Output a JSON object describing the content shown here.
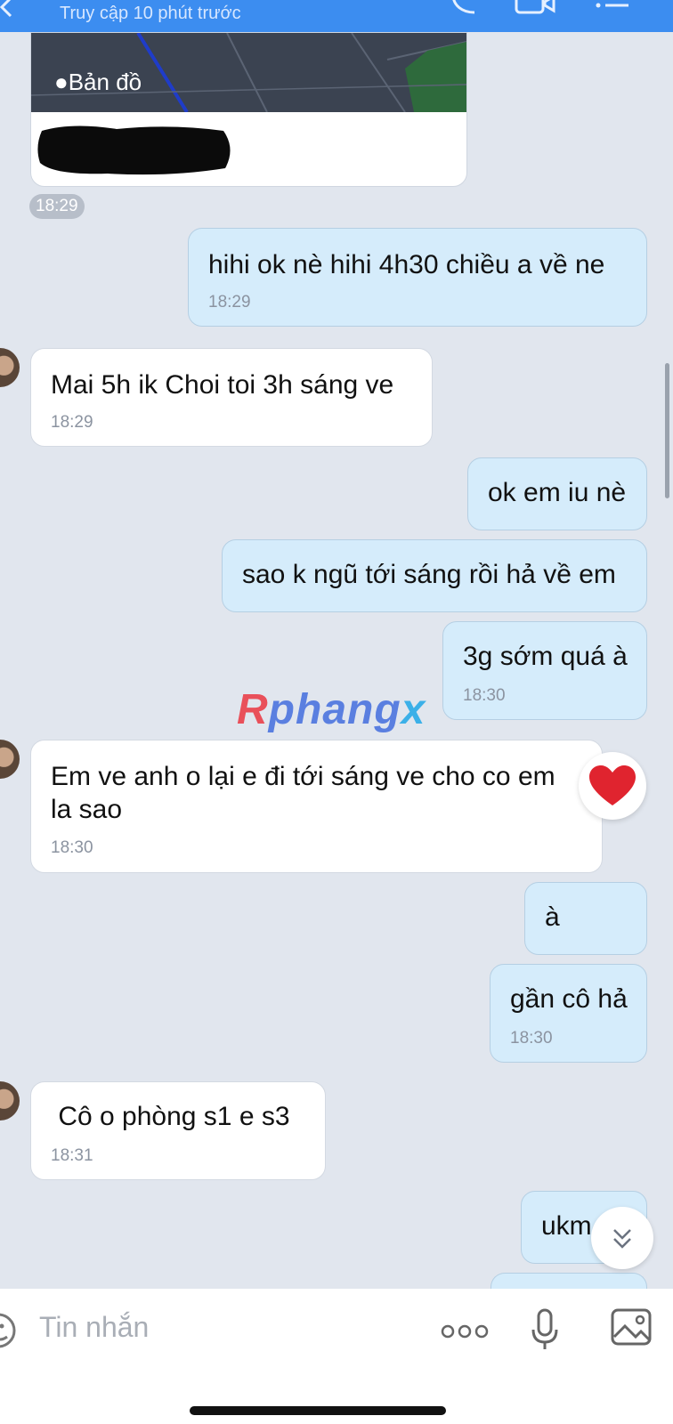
{
  "header": {
    "subtitle": "Truy cập 10 phút trước",
    "icons": [
      "back-arrow-icon",
      "phone-icon",
      "video-icon",
      "menu-icon"
    ]
  },
  "map_card": {
    "label": "Bản đồ",
    "time": "18:29"
  },
  "messages": [
    {
      "dir": "out",
      "text": "hihi ok nè hihi 4h30 chiều a về ne",
      "time": "18:29"
    },
    {
      "dir": "in",
      "text": "Mai 5h ik Choi toi 3h sáng ve",
      "time": "18:29"
    },
    {
      "dir": "out",
      "text": "ok em iu nè",
      "time": ""
    },
    {
      "dir": "out",
      "text": "sao k ngũ tới sáng rồi hả về em",
      "time": ""
    },
    {
      "dir": "out",
      "text": "3g sớm quá à",
      "time": "18:30"
    },
    {
      "dir": "in",
      "text_line1": "Em ve anh o lại e đi tới sáng ve cho co em",
      "text_line2": "la sao",
      "time": "18:30",
      "reaction": "heart-icon"
    },
    {
      "dir": "out",
      "text": "à",
      "time": ""
    },
    {
      "dir": "out",
      "text": "gần cô hả",
      "time": "18:30"
    },
    {
      "dir": "in",
      "text": " Cô o phòng s1 e s3",
      "time": "18:31"
    },
    {
      "dir": "out",
      "text": "ukm",
      "time": ""
    }
  ],
  "watermark": {
    "part1": "R",
    "part2": "phang",
    "part3": "x"
  },
  "composer": {
    "placeholder": "Tin nhắn",
    "icons": [
      "sticker-icon",
      "more-icon",
      "microphone-icon",
      "image-icon"
    ]
  },
  "colors": {
    "header": "#3c8df0",
    "background": "#e1e6ee",
    "outgoing_bubble": "#d5ecfb",
    "incoming_bubble": "#ffffff"
  }
}
